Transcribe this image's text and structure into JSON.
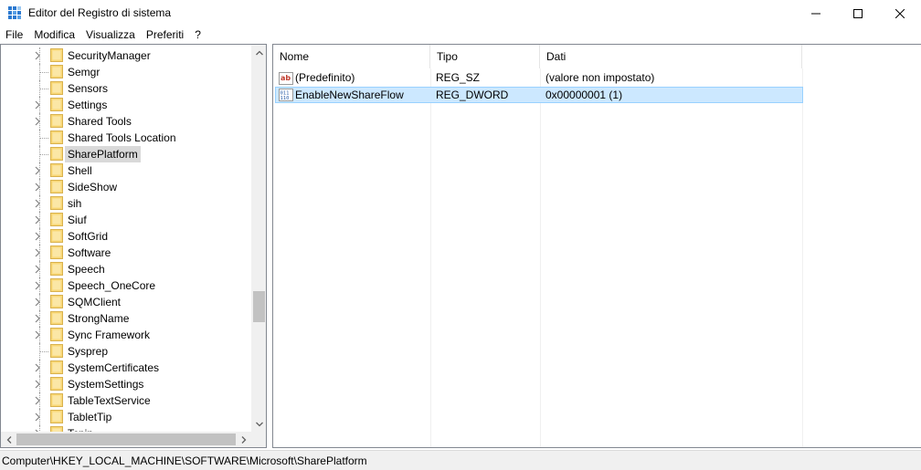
{
  "window": {
    "title": "Editor del Registro di sistema"
  },
  "menu": [
    "File",
    "Modifica",
    "Visualizza",
    "Preferiti",
    "?"
  ],
  "tree": {
    "items": [
      {
        "label": "SecurityManager",
        "expandable": true
      },
      {
        "label": "Semgr",
        "expandable": false
      },
      {
        "label": "Sensors",
        "expandable": false
      },
      {
        "label": "Settings",
        "expandable": true
      },
      {
        "label": "Shared Tools",
        "expandable": true
      },
      {
        "label": "Shared Tools Location",
        "expandable": false
      },
      {
        "label": "SharePlatform",
        "expandable": false,
        "selected": true
      },
      {
        "label": "Shell",
        "expandable": true
      },
      {
        "label": "SideShow",
        "expandable": true
      },
      {
        "label": "sih",
        "expandable": true
      },
      {
        "label": "Siuf",
        "expandable": true
      },
      {
        "label": "SoftGrid",
        "expandable": true
      },
      {
        "label": "Software",
        "expandable": true
      },
      {
        "label": "Speech",
        "expandable": true
      },
      {
        "label": "Speech_OneCore",
        "expandable": true
      },
      {
        "label": "SQMClient",
        "expandable": true
      },
      {
        "label": "StrongName",
        "expandable": true
      },
      {
        "label": "Sync Framework",
        "expandable": true
      },
      {
        "label": "Sysprep",
        "expandable": false
      },
      {
        "label": "SystemCertificates",
        "expandable": true
      },
      {
        "label": "SystemSettings",
        "expandable": true
      },
      {
        "label": "TableTextService",
        "expandable": true
      },
      {
        "label": "TabletTip",
        "expandable": true
      },
      {
        "label": "Tcpip",
        "expandable": true
      }
    ]
  },
  "list": {
    "columns": {
      "name": "Nome",
      "type": "Tipo",
      "data": "Dati"
    },
    "rows": [
      {
        "icon": "string-value-icon",
        "name": "(Predefinito)",
        "type": "REG_SZ",
        "data": "(valore non impostato)",
        "selected": false
      },
      {
        "icon": "dword-value-icon",
        "name": "EnableNewShareFlow",
        "type": "REG_DWORD",
        "data": "0x00000001 (1)",
        "selected": true
      }
    ]
  },
  "status": {
    "path": "Computer\\HKEY_LOCAL_MACHINE\\SOFTWARE\\Microsoft\\SharePlatform"
  },
  "colors": {
    "selection": "#cce8ff",
    "selection_border": "#99d1ff",
    "folder": "#f8d775",
    "tree_selected": "#d9d9d9"
  }
}
